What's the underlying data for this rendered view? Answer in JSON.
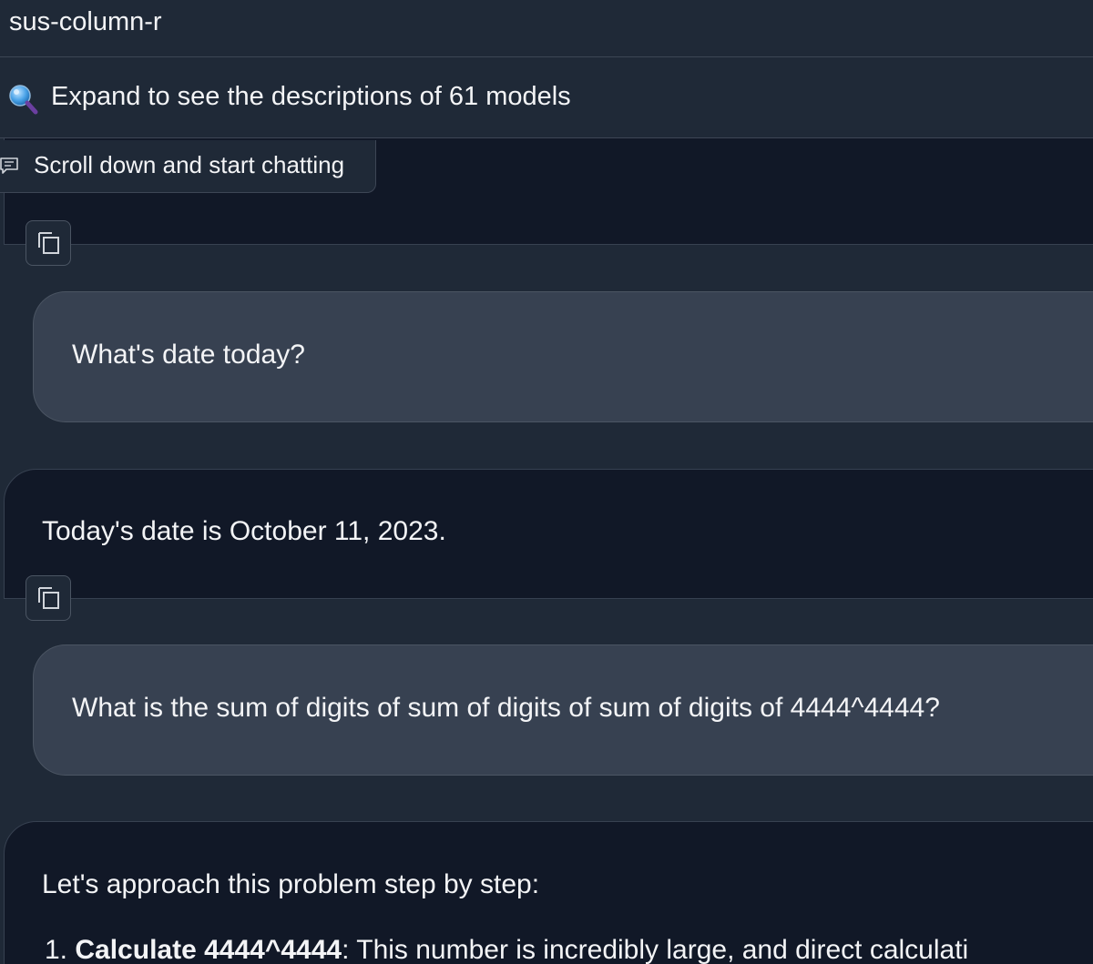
{
  "model_field": {
    "value": "sus-column-r"
  },
  "accordion": {
    "label": "Expand to see the descriptions of 61 models",
    "icon": "magnifier-icon"
  },
  "scroll_hint": {
    "label": "Scroll down and start chatting",
    "icon": "chat-icon"
  },
  "conversation": {
    "user_1": "What's date today?",
    "bot_1": "Today's date is October 11, 2023.",
    "user_2": "What is the sum of digits of sum of digits of sum of digits of 4444^4444?",
    "bot_2_intro": "Let's approach this problem step by step:",
    "bot_2_step_number": "1.",
    "bot_2_step_title": "Calculate 4444^4444",
    "bot_2_step_text": ": This number is incredibly large, and direct calculati"
  }
}
